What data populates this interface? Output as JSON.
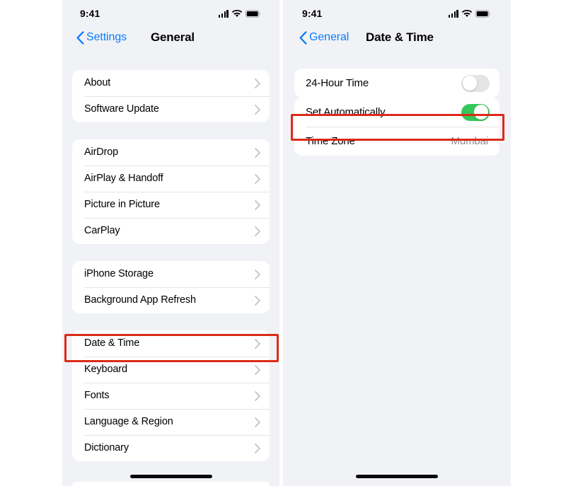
{
  "left_phone": {
    "status_bar": {
      "time": "9:41",
      "signal_icon": "cellular-signal-icon",
      "wifi_icon": "wifi-icon",
      "battery_icon": "battery-full-icon"
    },
    "nav": {
      "back_label": "Settings",
      "back_icon": "chevron-left-icon",
      "title": "General"
    },
    "groups": [
      {
        "rows": [
          {
            "label": "About",
            "accessory": "chevron-right-icon"
          },
          {
            "label": "Software Update",
            "accessory": "chevron-right-icon"
          }
        ]
      },
      {
        "rows": [
          {
            "label": "AirDrop",
            "accessory": "chevron-right-icon"
          },
          {
            "label": "AirPlay & Handoff",
            "accessory": "chevron-right-icon"
          },
          {
            "label": "Picture in Picture",
            "accessory": "chevron-right-icon"
          },
          {
            "label": "CarPlay",
            "accessory": "chevron-right-icon"
          }
        ]
      },
      {
        "rows": [
          {
            "label": "iPhone Storage",
            "accessory": "chevron-right-icon"
          },
          {
            "label": "Background App Refresh",
            "accessory": "chevron-right-icon"
          }
        ]
      },
      {
        "rows": [
          {
            "label": "Date & Time",
            "accessory": "chevron-right-icon",
            "highlighted": true
          },
          {
            "label": "Keyboard",
            "accessory": "chevron-right-icon"
          },
          {
            "label": "Fonts",
            "accessory": "chevron-right-icon"
          },
          {
            "label": "Language & Region",
            "accessory": "chevron-right-icon"
          },
          {
            "label": "Dictionary",
            "accessory": "chevron-right-icon"
          }
        ]
      }
    ]
  },
  "right_phone": {
    "status_bar": {
      "time": "9:41",
      "signal_icon": "cellular-signal-icon",
      "wifi_icon": "wifi-icon",
      "battery_icon": "battery-full-icon"
    },
    "nav": {
      "back_label": "General",
      "back_icon": "chevron-left-icon",
      "title": "Date & Time"
    },
    "groups": [
      {
        "rows": [
          {
            "label": "24-Hour Time",
            "control": "toggle",
            "toggle_state": "off"
          }
        ]
      },
      {
        "rows": [
          {
            "label": "Set Automatically",
            "control": "toggle",
            "toggle_state": "on",
            "highlighted": true
          },
          {
            "label": "Time Zone",
            "value": "Mumbai"
          }
        ]
      }
    ]
  },
  "colors": {
    "accent_blue": "#0a7cff",
    "toggle_on_green": "#34c759",
    "toggle_off_gray": "#e4e4e7",
    "highlight_red": "#dc2a19",
    "panel_background": "#f1f2f6",
    "card_background": "#ffffff",
    "value_text_gray": "#8a8a8e"
  }
}
